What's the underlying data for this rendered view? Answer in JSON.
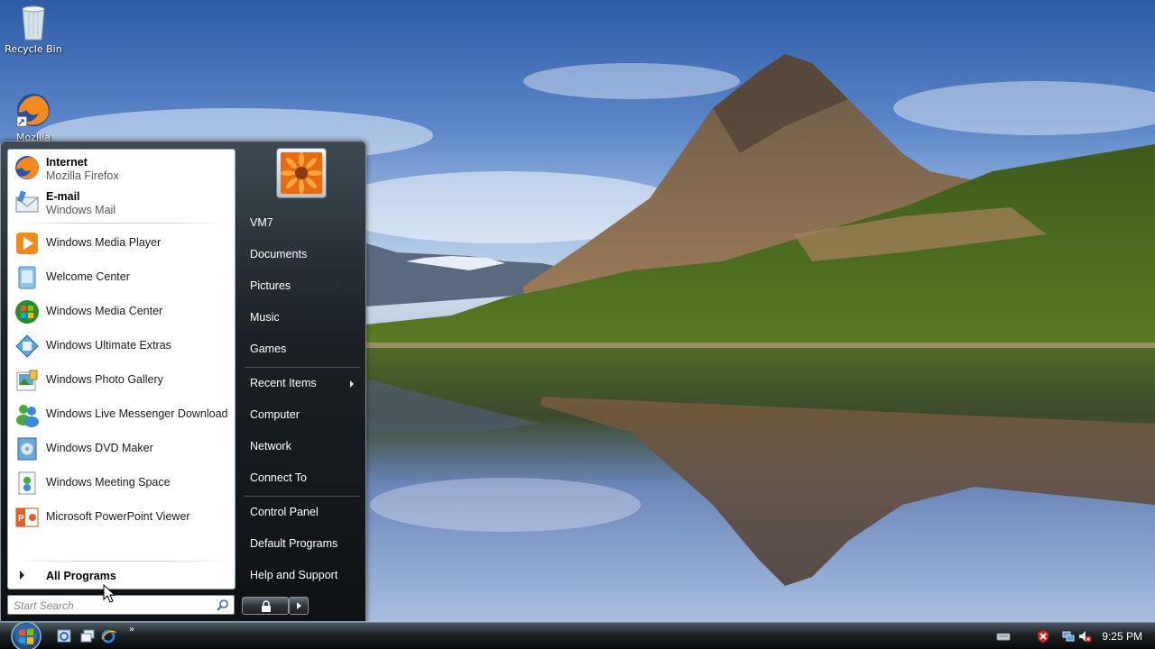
{
  "desktop": {
    "icons": [
      {
        "name": "Recycle Bin",
        "label": "Recycle Bin"
      },
      {
        "name": "Mozilla Firefox shortcut",
        "label": "Mozilla"
      }
    ]
  },
  "start_menu": {
    "pinned": [
      {
        "title": "Internet",
        "subtitle": "Mozilla Firefox",
        "icon": "firefox-icon"
      },
      {
        "title": "E-mail",
        "subtitle": "Windows Mail",
        "icon": "mail-icon"
      }
    ],
    "programs": [
      {
        "label": "Windows Media Player",
        "icon": "media-player-icon"
      },
      {
        "label": "Welcome Center",
        "icon": "welcome-center-icon"
      },
      {
        "label": "Windows Media Center",
        "icon": "media-center-icon"
      },
      {
        "label": "Windows Ultimate Extras",
        "icon": "ultimate-extras-icon"
      },
      {
        "label": "Windows Photo Gallery",
        "icon": "photo-gallery-icon"
      },
      {
        "label": "Windows Live Messenger Download",
        "icon": "messenger-icon"
      },
      {
        "label": "Windows DVD Maker",
        "icon": "dvd-maker-icon"
      },
      {
        "label": "Windows Meeting Space",
        "icon": "meeting-space-icon"
      },
      {
        "label": "Microsoft PowerPoint Viewer",
        "icon": "powerpoint-icon"
      }
    ],
    "all_programs_label": "All Programs",
    "search_placeholder": "Start Search",
    "right_items": [
      {
        "label": "VM7"
      },
      {
        "label": "Documents"
      },
      {
        "label": "Pictures"
      },
      {
        "label": "Music"
      },
      {
        "label": "Games"
      },
      {
        "label": "Recent Items",
        "submenu": true
      },
      {
        "label": "Computer"
      },
      {
        "label": "Network"
      },
      {
        "label": "Connect To"
      },
      {
        "label": "Control Panel"
      },
      {
        "label": "Default Programs"
      },
      {
        "label": "Help and Support"
      }
    ]
  },
  "taskbar": {
    "quick_launch": [
      "ie-shortcut-icon",
      "switch-windows-icon",
      "internet-explorer-icon"
    ],
    "more_indicator": "»",
    "tray_icons": [
      "keyboard-icon",
      "security-alert-icon",
      "network-icon",
      "volume-muted-icon"
    ],
    "clock": "9:25 PM"
  },
  "colors": {
    "menu_dark": "#0e1114",
    "menu_left_bg": "#ffffff",
    "taskbar": "#1d2327",
    "accent_orange": "#f28a1e"
  }
}
